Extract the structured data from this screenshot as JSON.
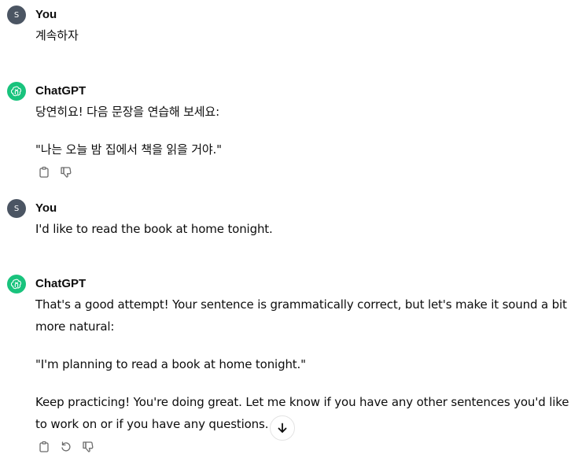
{
  "messages": [
    {
      "author": "You",
      "avatar_initial": "S",
      "text": "계속하자"
    },
    {
      "author": "ChatGPT",
      "line1": "당연히요! 다음 문장을 연습해 보세요:",
      "line2": "\"나는 오늘 밤 집에서 책을 읽을 거야.\""
    },
    {
      "author": "You",
      "avatar_initial": "S",
      "text": "I'd like to read the book at home tonight."
    },
    {
      "author": "ChatGPT",
      "para1": "That's a good attempt! Your sentence is grammatically correct, but let's make it sound a bit more natural:",
      "para2": "\"I'm planning to read a book at home tonight.\"",
      "para3": "Keep practicing! You're doing great. Let me know if you have any other sentences you'd like to work on or if you have any questions."
    }
  ],
  "icons": {
    "copy": "copy-icon",
    "thumbs_down": "thumbs-down-icon",
    "regenerate": "regenerate-icon",
    "scroll_down": "arrow-down-icon"
  },
  "colors": {
    "gpt_avatar": "#19c37d",
    "user_avatar": "#4b5563"
  }
}
